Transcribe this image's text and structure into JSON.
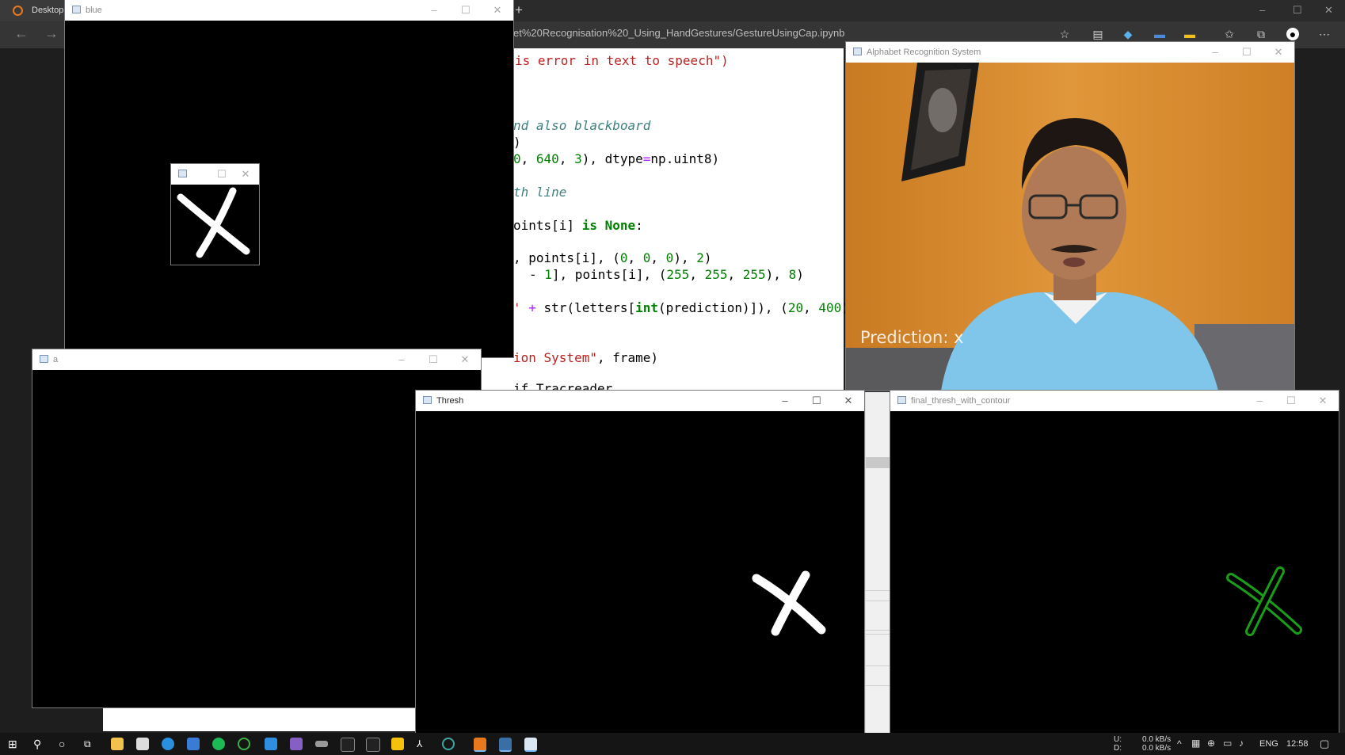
{
  "browser": {
    "tab_label": "Desktop",
    "url": "et%20Recognisation%20_Using_HandGestures/GestureUsingCap.ipynb",
    "new_tab_symbol": "+"
  },
  "code_lines": [
    {
      "parts": [
        [
          "str",
          "is error in text to speech\")"
        ]
      ]
    },
    {
      "parts": [
        [
          "cmt",
          "nd also blackboard"
        ]
      ]
    },
    {
      "parts": [
        [
          "plain",
          ")"
        ]
      ]
    },
    {
      "parts": [
        [
          "num",
          "0"
        ],
        [
          "plain",
          ", "
        ],
        [
          "num",
          "640"
        ],
        [
          "plain",
          ", "
        ],
        [
          "num",
          "3"
        ],
        [
          "plain",
          "), dtype"
        ],
        [
          "op",
          "="
        ],
        [
          "plain",
          "np.uint8)"
        ]
      ]
    },
    {
      "parts": [
        [
          "cmt",
          "th line"
        ]
      ]
    },
    {
      "parts": [
        [
          "plain",
          "oints[i] "
        ],
        [
          "kw",
          "is None"
        ],
        [
          "plain",
          ":"
        ]
      ]
    },
    {
      "parts": [
        [
          "plain",
          ", points[i], ("
        ],
        [
          "num",
          "0"
        ],
        [
          "plain",
          ", "
        ],
        [
          "num",
          "0"
        ],
        [
          "plain",
          ", "
        ],
        [
          "num",
          "0"
        ],
        [
          "plain",
          "), "
        ],
        [
          "num",
          "2"
        ],
        [
          "plain",
          ")"
        ]
      ]
    },
    {
      "parts": [
        [
          "plain",
          "- "
        ],
        [
          "num",
          "1"
        ],
        [
          "plain",
          "], points[i], ("
        ],
        [
          "num",
          "255"
        ],
        [
          "plain",
          ", "
        ],
        [
          "num",
          "255"
        ],
        [
          "plain",
          ", "
        ],
        [
          "num",
          "255"
        ],
        [
          "plain",
          "), "
        ],
        [
          "num",
          "8"
        ],
        [
          "plain",
          ")"
        ]
      ]
    },
    {
      "parts": [
        [
          "str",
          "' "
        ],
        [
          "op",
          "+"
        ],
        [
          "plain",
          " str(letters["
        ],
        [
          "kw",
          "int"
        ],
        [
          "plain",
          "(prediction)]), ("
        ],
        [
          "num",
          "20"
        ],
        [
          "plain",
          ", "
        ],
        [
          "num",
          "400"
        ],
        [
          "plain",
          "),"
        ]
      ]
    },
    {
      "parts": [
        [
          "str",
          "ion System\""
        ],
        [
          "plain",
          ", frame)"
        ]
      ]
    },
    {
      "parts": [
        [
          "plain",
          "if Tracreader"
        ]
      ]
    }
  ],
  "windows": {
    "blue": {
      "title": "blue"
    },
    "a": {
      "title": "a"
    },
    "thresh": {
      "title": "Thresh"
    },
    "final": {
      "title": "final_thresh_with_contour"
    },
    "alphabet": {
      "title": "Alphabet Recognition System",
      "prediction_text": "Prediction: x"
    },
    "small": {
      "title": ""
    }
  },
  "window_buttons": {
    "minimize": "–",
    "maximize": "☐",
    "close": "✕"
  },
  "taskbar": {
    "net_up": "0.0 kB/s",
    "net_down": "0.0 kB/s",
    "net_up_label": "U:",
    "net_down_label": "D:",
    "lang": "ENG",
    "time": "12:58"
  },
  "colors": {
    "contour": "#1a9e1a",
    "background": "#000000",
    "wall": "#d98a2c",
    "shirt": "#7fc6ea"
  }
}
